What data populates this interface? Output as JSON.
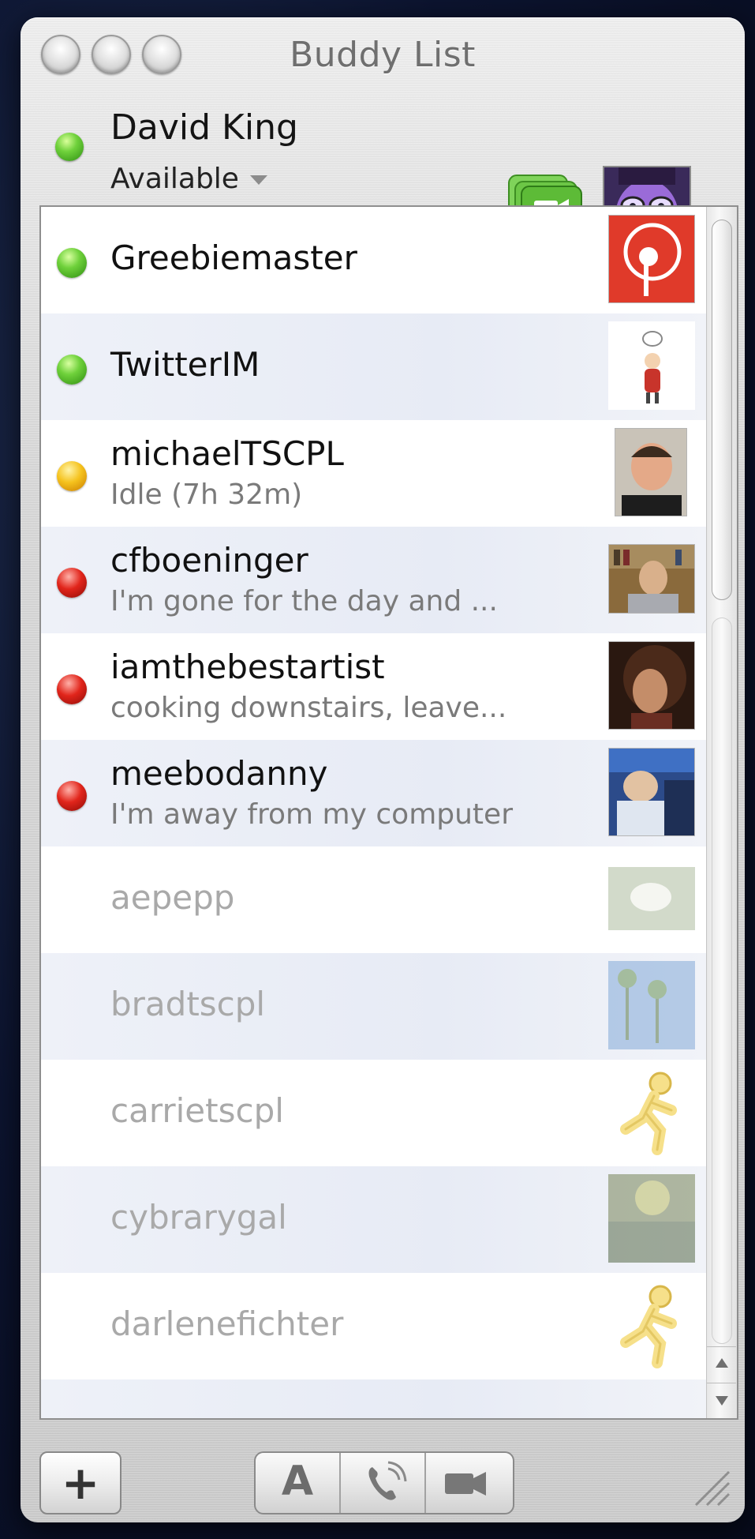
{
  "window": {
    "title": "Buddy List"
  },
  "me": {
    "name": "David King",
    "status": "Available",
    "status_color": "#5cc22e"
  },
  "buddies": [
    {
      "name": "Greebiemaster",
      "message": "",
      "status": "green",
      "offline": false
    },
    {
      "name": "TwitterIM",
      "message": "",
      "status": "green",
      "offline": false
    },
    {
      "name": "michaelTSCPL",
      "message": "Idle (7h 32m)",
      "status": "yellow",
      "offline": false
    },
    {
      "name": "cfboeninger",
      "message": "I'm gone for the day and ...",
      "status": "red",
      "offline": false
    },
    {
      "name": "iamthebestartist",
      "message": "cooking downstairs, leave...",
      "status": "red",
      "offline": false
    },
    {
      "name": "meebodanny",
      "message": "I'm away from my computer",
      "status": "red",
      "offline": false
    },
    {
      "name": "aepepp",
      "message": "",
      "status": "none",
      "offline": true
    },
    {
      "name": "bradtscpl",
      "message": "",
      "status": "none",
      "offline": true
    },
    {
      "name": "carrietscpl",
      "message": "",
      "status": "none",
      "offline": true
    },
    {
      "name": "cybrarygal",
      "message": "",
      "status": "none",
      "offline": true
    },
    {
      "name": "darlenefichter",
      "message": "",
      "status": "none",
      "offline": true
    }
  ],
  "toolbar": {
    "add_label": "+",
    "text_chat_label": "A"
  },
  "icons": {
    "add": "plus-icon",
    "text_chat": "text-chat-icon",
    "audio_chat": "phone-icon",
    "video_chat": "video-camera-icon",
    "aim_running_man": "aim-running-man-icon"
  }
}
